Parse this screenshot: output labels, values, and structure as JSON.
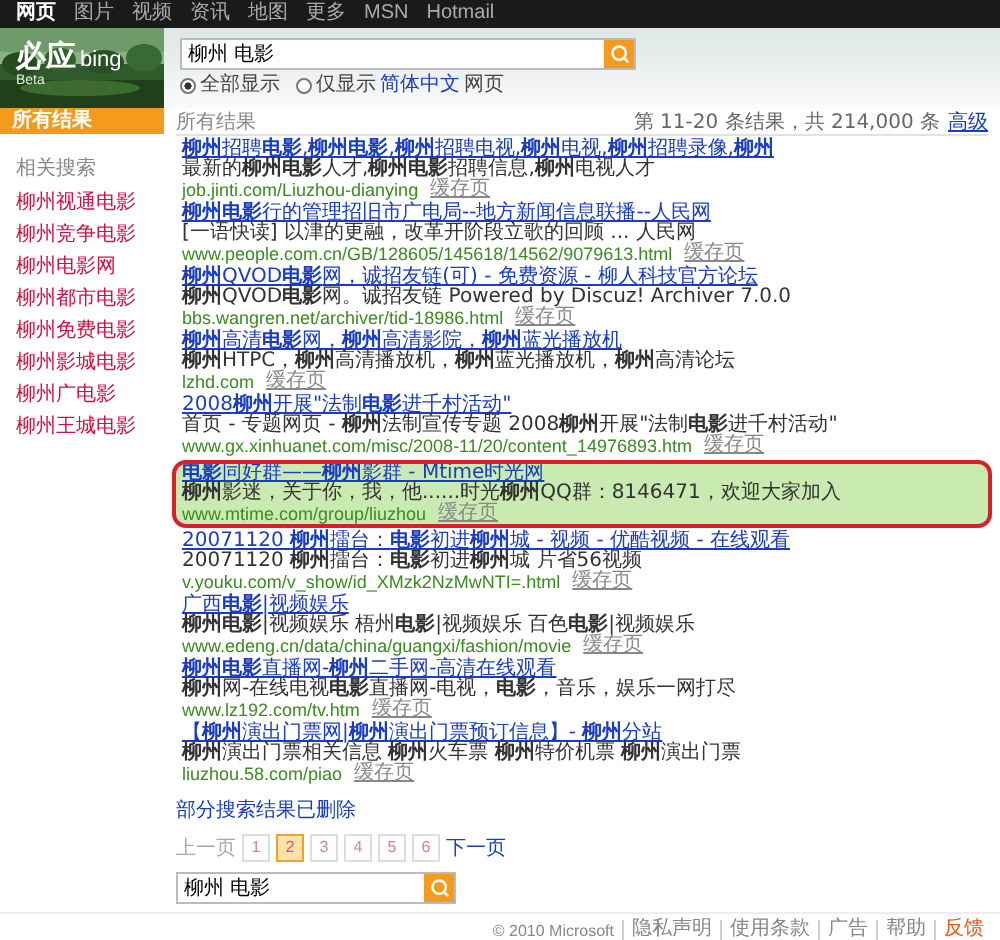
{
  "top_nav": [
    {
      "label": "网页",
      "selected": true
    },
    {
      "label": "图片",
      "selected": false
    },
    {
      "label": "视频",
      "selected": false
    },
    {
      "label": "资讯",
      "selected": false
    },
    {
      "label": "地图",
      "selected": false
    },
    {
      "label": "更多",
      "selected": false
    },
    {
      "label": "MSN",
      "selected": false
    },
    {
      "label": "Hotmail",
      "selected": false
    }
  ],
  "logo": {
    "name": "必应",
    "brand": "bing",
    "badge": "Beta"
  },
  "search": {
    "value": "柳州 电影"
  },
  "language_options": [
    {
      "label": "全部显示",
      "selected": true
    },
    {
      "label": "仅显示",
      "link": "简体中文",
      "after": "网页",
      "selected": false
    }
  ],
  "sidebar": {
    "scope": {
      "label": "所有结果",
      "selected": true
    },
    "related_heading": "相关搜索",
    "related": [
      "柳州视通电影",
      "柳州竞争电影",
      "柳州电影网",
      "柳州都市电影",
      "柳州免费电影",
      "柳州影城电影",
      "柳州广电影",
      "柳州王城电影"
    ]
  },
  "results_header": {
    "title": "所有结果",
    "count": "第 11-20 条结果，共 214,000 条",
    "advanced": "高级"
  },
  "results": [
    {
      "title": "**柳州**招聘**电影**,**柳州电影**,**柳州**招聘电视,**柳州**电视,**柳州**招聘录像,**柳州**",
      "snippet": "最新的**柳州电影**人才,**柳州电影**招聘信息,**柳州**电视人才",
      "url": "job.jinti.com/Liuzhou-dianying",
      "cache": "缓存页",
      "highlighted": false
    },
    {
      "title": "**柳州电影**行的管理招旧市广电局--地方新闻信息联播--人民网",
      "snippet": "[一语快读] 以津的更融，改革开阶段立歌的回顾 ... 人民网",
      "url": "www.people.com.cn/GB/128605/145618/14562/9079613.html",
      "cache": "缓存页",
      "highlighted": false
    },
    {
      "title": "**柳州**QVOD**电影**网，诚招友链(可) - 免费资源 - 柳人科技官方论坛",
      "snippet": "**柳州**QVOD**电影**网。诚招友链 Powered by Discuz! Archiver 7.0.0",
      "url": "bbs.wangren.net/archiver/tid-18986.html",
      "cache": "缓存页",
      "highlighted": false
    },
    {
      "title": "**柳州**高清**电影**网，**柳州**高清影院，**柳州**蓝光播放机",
      "snippet": "**柳州**HTPC，**柳州**高清播放机，**柳州**蓝光播放机，**柳州**高清论坛",
      "url": "lzhd.com",
      "cache": "缓存页",
      "highlighted": false
    },
    {
      "title": "2008**柳州**开展\"法制**电影**进千村活动\"",
      "snippet": "首页 - 专题网页 - **柳州**法制宣传专题 2008**柳州**开展\"法制**电影**进千村活动\"",
      "url": "www.gx.xinhuanet.com/misc/2008-11/20/content_14976893.htm",
      "cache": "缓存页",
      "highlighted": false
    },
    {
      "title": "**电影**同好群——**柳州**影群 - Mtime时光网",
      "snippet": "**柳州**影迷，关于你，我，他......时光**柳州**QQ群：8146471，欢迎大家加入",
      "url": "www.mtime.com/group/liuzhou",
      "cache": "缓存页",
      "highlighted": true
    },
    {
      "title": "20071120 **柳州**擂台：**电影**初进**柳州**城 - 视频 - 优酷视频 - 在线观看",
      "snippet": "20071120 **柳州**擂台：**电影**初进**柳州**城 片省56视频",
      "url": "v.youku.com/v_show/id_XMzk2NzMwNTI=.html",
      "cache": "缓存页",
      "highlighted": false
    },
    {
      "title": "广西**电影**|视频娱乐",
      "snippet": "**柳州电影**|视频娱乐 梧州**电影**|视频娱乐 百色**电影**|视频娱乐",
      "url": "www.edeng.cn/data/china/guangxi/fashion/movie",
      "cache": "缓存页",
      "highlighted": false
    },
    {
      "title": "**柳州电影**直播网-**柳州**二手网-高清在线观看",
      "snippet": "**柳州**网-在线电视**电影**直播网-电视，**电影**，音乐，娱乐一网打尽",
      "url": "www.lz192.com/tv.htm",
      "cache": "缓存页",
      "highlighted": false
    },
    {
      "title": "【**柳州**演出门票网|**柳州**演出门票预订信息】- **柳州**分站",
      "snippet": "**柳州**演出门票相关信息 **柳州**火车票 **柳州**特价机票 **柳州**演出门票",
      "url": "liuzhou.58.com/piao",
      "cache": "缓存页",
      "highlighted": false
    }
  ],
  "removed_note": "部分搜索结果已删除",
  "pagination": {
    "previous": "上一页",
    "pages": [
      {
        "label": "1",
        "selected": false
      },
      {
        "label": "2",
        "selected": true
      },
      {
        "label": "3",
        "selected": false
      },
      {
        "label": "4",
        "selected": false
      },
      {
        "label": "5",
        "selected": false
      },
      {
        "label": "6",
        "selected": false
      }
    ],
    "next": "下一页"
  },
  "bottom_search": {
    "value": "柳州 电影"
  },
  "footer": {
    "copyright": "© 2010 Microsoft",
    "links": [
      {
        "label": "隐私声明",
        "accent": false
      },
      {
        "label": "使用条款",
        "accent": false
      },
      {
        "label": "广告",
        "accent": false
      },
      {
        "label": "帮助",
        "accent": false
      },
      {
        "label": "反馈",
        "accent": true
      }
    ]
  }
}
